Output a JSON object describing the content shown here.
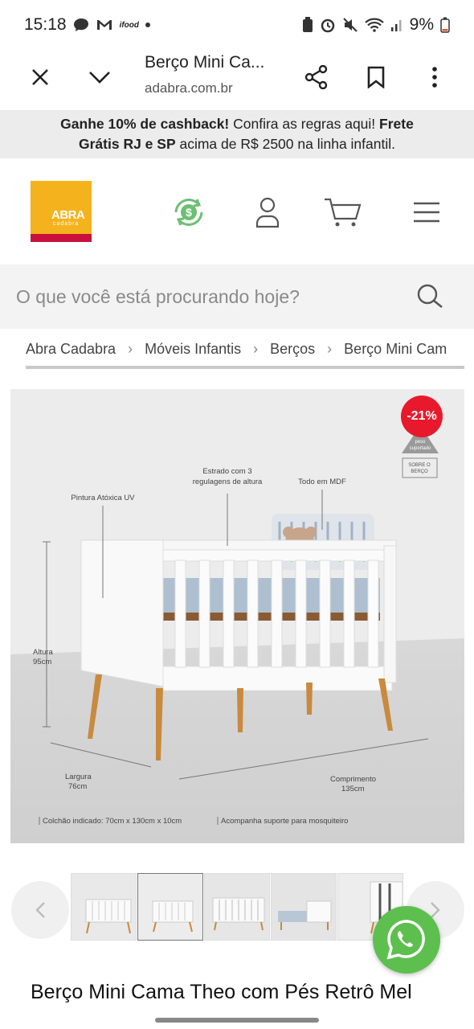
{
  "status_bar": {
    "time": "15:18",
    "battery": "9%",
    "notif_text": "ifood"
  },
  "browser": {
    "title": "Berço Mini Ca...",
    "url": "adabra.com.br"
  },
  "promo": {
    "bold1": "Ganhe 10% de cashback!",
    "text1": " Confira as regras aqui! ",
    "bold2": "Frete",
    "bold3": "Grátis RJ e SP",
    "text2": " acima de R$ 2500 na linha infantil."
  },
  "header": {
    "logo_text": "ABRA",
    "logo_sub": "cadabra",
    "colors": {
      "logo_yellow": "#f4b21c",
      "logo_red": "#c8123d",
      "cashback_green": "#6dbf73"
    }
  },
  "search": {
    "placeholder": "O que você está procurando hoje?"
  },
  "breadcrumb": [
    "Abra Cadabra",
    "Móveis Infantis",
    "Berços",
    "Berço Mini Cam"
  ],
  "product_image": {
    "discount_badge": "-21%",
    "annotations": {
      "pintura": "Pintura Atóxica UV",
      "estrado1": "Estrado com 3",
      "estrado2": "regulagens de altura",
      "mdf": "Todo em MDF",
      "altura1": "Altura",
      "altura2": "95cm",
      "largura1": "Largura",
      "largura2": "76cm",
      "comprimento1": "Comprimento",
      "comprimento2": "135cm",
      "colchao": "Colchão indicado: 70cm x 130cm x 10cm",
      "suporte": "Acompanha suporte para mosquiteiro",
      "peso1": "30kg",
      "peso2": "peso",
      "peso3": "suportado",
      "sobre1": "SOBRE O",
      "sobre2": "BERÇO"
    }
  },
  "product": {
    "title": "Berço Mini Cama Theo com Pés Retrô Mel"
  }
}
